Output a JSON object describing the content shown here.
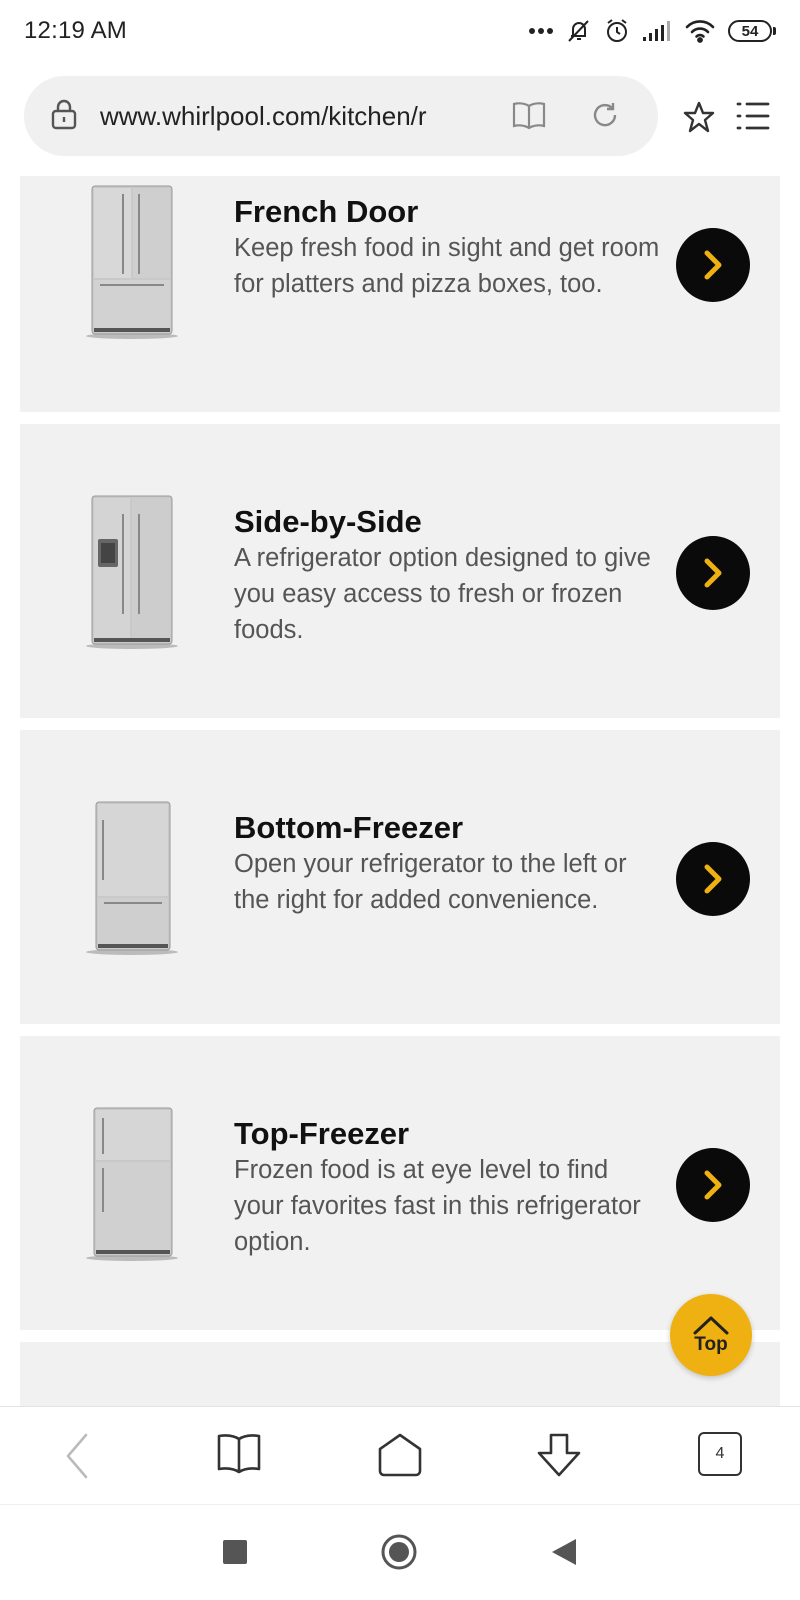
{
  "status_bar": {
    "time": "12:19 AM",
    "battery": "54",
    "icons": [
      "more-dots-icon",
      "mute-icon",
      "alarm-icon",
      "signal-icon",
      "wifi-icon",
      "battery-icon"
    ]
  },
  "browser": {
    "url": "www.whirlpool.com/kitchen/r",
    "tab_count": "4"
  },
  "cards": [
    {
      "title": "French Door",
      "description": "Keep fresh food in sight and get room for platters and pizza boxes, too."
    },
    {
      "title": "Side-by-Side",
      "description": "A refrigerator option designed to give you easy access to fresh or frozen foods."
    },
    {
      "title": "Bottom-Freezer",
      "description": "Open your refrigerator to the left or the right for added convenience."
    },
    {
      "title": "Top-Freezer",
      "description": "Frozen food is at eye level to find your favorites fast in this refrigerator option."
    }
  ],
  "top_button": {
    "label": "Top"
  },
  "colors": {
    "accent": "#eeb111",
    "card_bg": "#f1f1f1",
    "arrow_bg": "#0a0a0a"
  }
}
